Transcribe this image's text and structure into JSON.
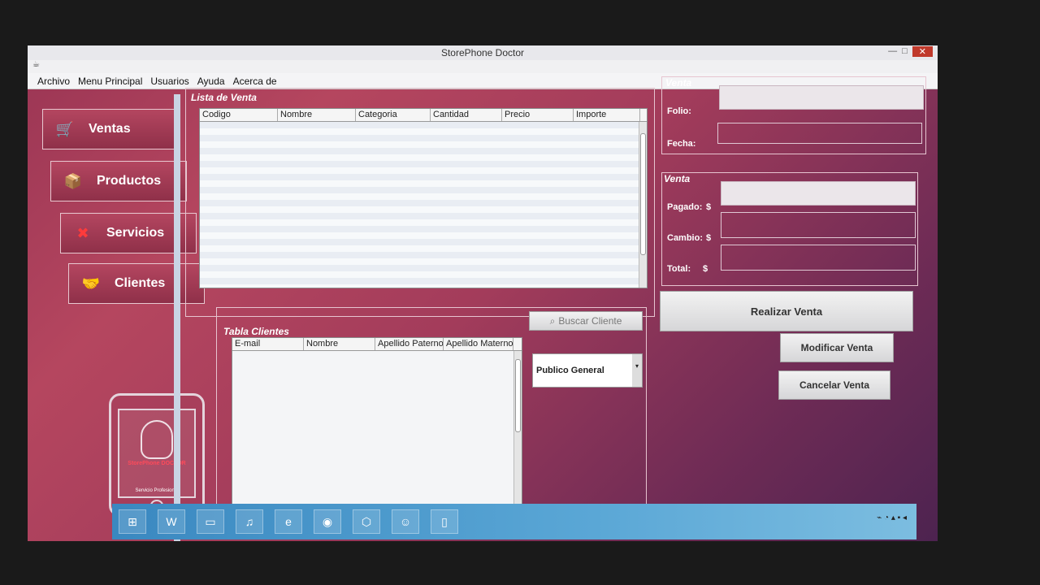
{
  "window": {
    "title": "StorePhone Doctor",
    "controls": [
      "—",
      "□",
      "✕"
    ]
  },
  "menu": [
    "Archivo",
    "Menu Principal",
    "Usuarios",
    "Ayuda",
    "Acerca de"
  ],
  "sidebar": {
    "items": [
      {
        "label": "Ventas",
        "icon": "cart-icon"
      },
      {
        "label": "Productos",
        "icon": "box-icon"
      },
      {
        "label": "Servicios",
        "icon": "tools-icon"
      },
      {
        "label": "Clientes",
        "icon": "handshake-icon"
      }
    ],
    "logo": {
      "brand": "StorePhone DOCTOR",
      "subtitle": "Servicio Profesional"
    }
  },
  "sales_list": {
    "title": "Lista de Venta",
    "columns": [
      "Codigo",
      "Nombre",
      "Categoria",
      "Cantidad",
      "Precio",
      "Importe"
    ],
    "rows": []
  },
  "clients_table": {
    "title": "Tabla Clientes",
    "columns": [
      "E-mail",
      "Nombre",
      "Apellido Paterno",
      "Apellido Materno"
    ],
    "rows": []
  },
  "search_client": {
    "label": "Buscar Cliente",
    "icon": "search-icon"
  },
  "client_type": {
    "selected": "Publico General"
  },
  "venta_panel": {
    "title": "Venta",
    "folio_label": "Folio:",
    "folio_value": "",
    "fecha_label": "Fecha:",
    "fecha_value": ""
  },
  "payment_panel": {
    "title": "Venta",
    "pagado_label": "Pagado:",
    "cambio_label": "Cambio:",
    "total_label": "Total:",
    "currency": "$",
    "pagado_value": "",
    "cambio_value": "",
    "total_value": ""
  },
  "actions": {
    "realizar": "Realizar Venta",
    "modificar": "Modificar Venta",
    "cancelar": "Cancelar Venta"
  }
}
